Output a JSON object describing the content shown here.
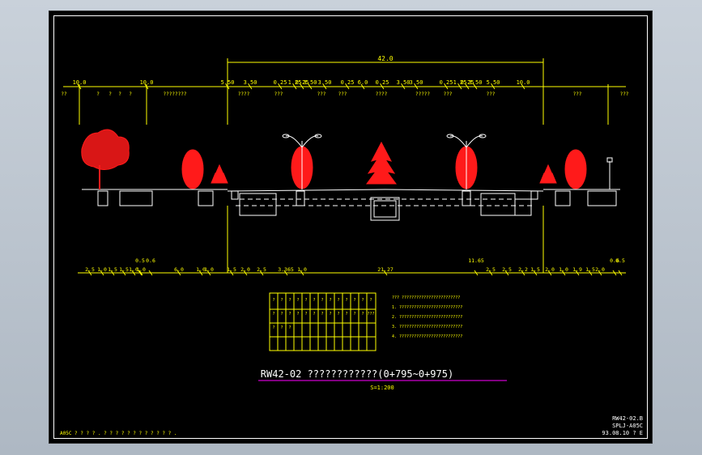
{
  "drawing": {
    "title": "RW42-02 ????????????(0+795~0+975)",
    "scale": "S=1:200",
    "total_width": "42.0",
    "bottom_left_note": "A05C ? ? ? ? . ? ? ? ? ? ? ? ? ? ? ? ? .",
    "title_block": [
      "RW42-02.B",
      "SPLJ-A05C",
      "93.08.10 ? E"
    ]
  },
  "top_dimensions": [
    "10.0",
    "10.0",
    "5.50",
    "3.50",
    "0.25",
    "1.25",
    "0.25",
    "3.50",
    "3.50",
    "0.25",
    "6.0",
    "0.25",
    "3.50",
    "3.50",
    "0.25",
    "1.25",
    "0.25",
    "3.50",
    "5.50",
    "10.0"
  ],
  "top_labels": [
    "??",
    "?",
    "?",
    "?",
    "?",
    "????????",
    "????",
    "???",
    "???",
    "???",
    "????",
    "?????",
    "???",
    "???",
    "???",
    "???",
    "????????",
    "??"
  ],
  "bottom_dimensions": [
    "2.5",
    "1.0",
    "1.5",
    "1.5",
    "1.0",
    "1.0",
    "0.5",
    "0.6",
    "6.0",
    "1.0",
    "1.0",
    "1.5",
    "2.0",
    "2.5",
    "3.365",
    "1.0",
    "21.27",
    "11.65",
    "2.5",
    "2.5",
    "2.2",
    "1.5",
    "2.0",
    "1.0",
    "1.9",
    "1.5",
    "2.0",
    "0.6",
    "0.5"
  ],
  "notes": [
    "??? ????????????????????????",
    "1. ??????????????????????????",
    "2. ??????????????????????????",
    "3. ??????????????????????????",
    "4. ??????????????????????????"
  ],
  "table": {
    "cells": [
      "?",
      "?",
      "?",
      "?",
      "?",
      "?",
      "?",
      "?",
      "?",
      "?",
      "?",
      "?",
      "?",
      "?",
      "?",
      "?",
      "?",
      "?",
      "?",
      "?",
      "?",
      "?",
      "?",
      "?",
      "?",
      "???",
      "?",
      "?",
      "?"
    ]
  },
  "colors": {
    "dimension": "#ffff00",
    "trees": "#ff1a1a",
    "lines": "#ffffff",
    "title_underline": "#cc00cc"
  }
}
